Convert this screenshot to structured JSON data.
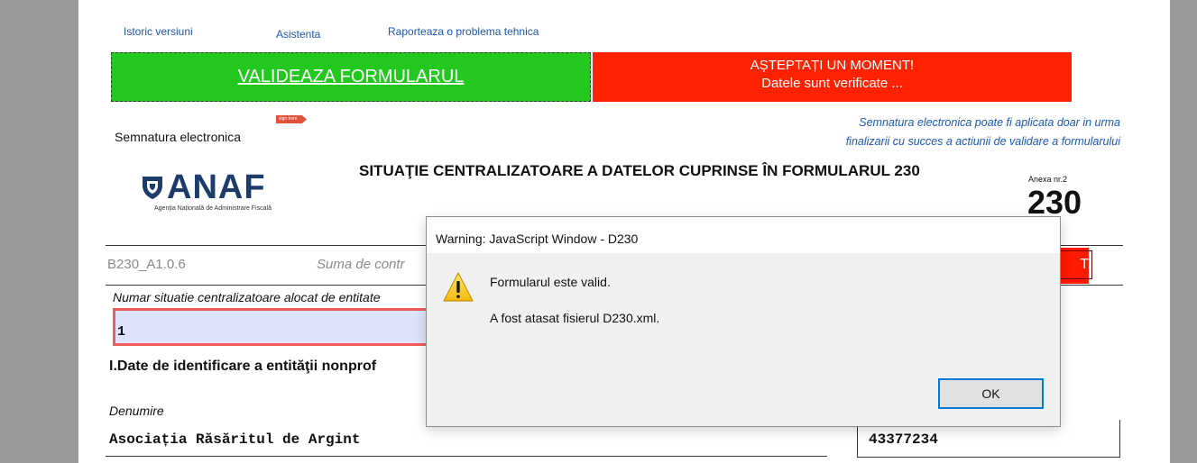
{
  "links": {
    "history": "Istoric versiuni",
    "help": "Asistenta",
    "report": "Raporteaza o problema tehnica"
  },
  "validate_button": "VALIDEAZA FORMULARUL",
  "wait_panel": {
    "line1": "AȘTEPTAȚI UN MOMENT!",
    "line2": "Datele sunt verificate ..."
  },
  "signature": {
    "label": "Semnatura electronica",
    "note_line1": "Semnatura electronica poate fi aplicata doar in urma",
    "note_line2": "finalizarii cu succes a actiunii de validare a formularului"
  },
  "logo": {
    "text": "ANAF",
    "subtitle": "Agenția Națională de Administrare Fiscală"
  },
  "document": {
    "title": "SITUAŢIE CENTRALIZATOARE A DATELOR CUPRINSE ÎN FORMULARUL 230",
    "anexa": "Anexa nr.2",
    "form_number": "230",
    "code": "B230_A1.0.6",
    "sum_label": "Suma de contr",
    "red_text": "T"
  },
  "fields": {
    "number_label": "Numar situatie centralizatoare alocat de entitate",
    "number_value": "1",
    "section_title": "I.Date de identificare a entităţii nonprof",
    "denumire_label": "Denumire",
    "denumire_value": "Asociația Răsăritul de Argint",
    "cif_value": "43377234"
  },
  "dialog": {
    "title": "Warning: JavaScript Window - D230",
    "message1": "Formularul este valid.",
    "message2": "A fost atasat fisierul D230.xml.",
    "ok_label": "OK"
  },
  "colors": {
    "validate_green": "#22c81e",
    "wait_red": "#ff2200",
    "link_blue": "#1a56b8",
    "anaf_blue": "#1c3d6b"
  }
}
